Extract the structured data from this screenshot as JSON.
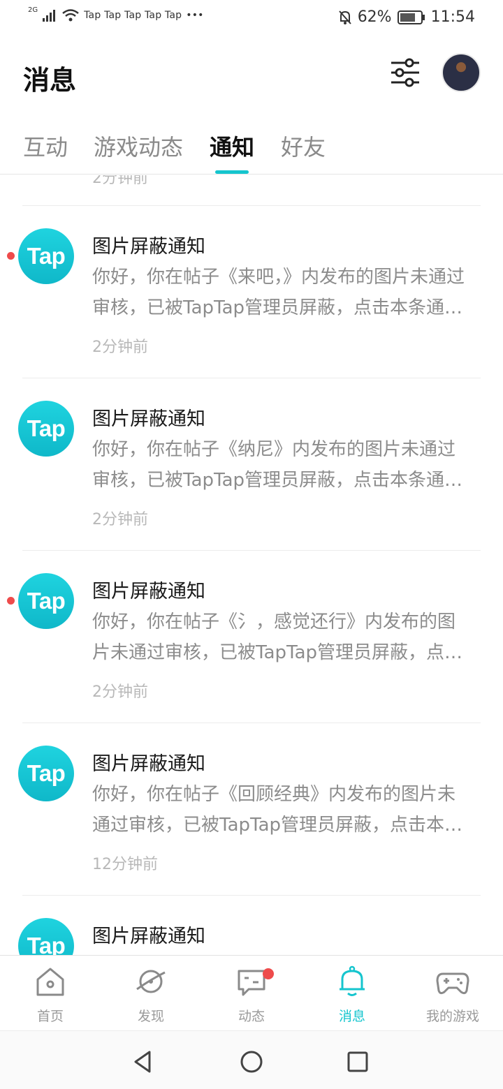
{
  "status_bar": {
    "network": "2G",
    "apps": "Tap Tap Tap Tap Tap",
    "more": "•••",
    "battery": "62%",
    "time": "11:54"
  },
  "header": {
    "title": "消息"
  },
  "tabs": [
    {
      "label": "互动",
      "active": false
    },
    {
      "label": "游戏动态",
      "active": false
    },
    {
      "label": "通知",
      "active": true
    },
    {
      "label": "好友",
      "active": false
    }
  ],
  "partial_prev_time": "2分钟前",
  "notifications": [
    {
      "logo": "Tap",
      "title": "图片屏蔽通知",
      "body": "你好，你在帖子《来吧，》内发布的图片未通过审核，已被TapTap管理员屏蔽，点击本条通知查看详情",
      "time": "2分钟前",
      "unread": true
    },
    {
      "logo": "Tap",
      "title": "图片屏蔽通知",
      "body": "你好，你在帖子《纳尼》内发布的图片未通过审核，已被TapTap管理员屏蔽，点击本条通知查看详情",
      "time": "2分钟前",
      "unread": false
    },
    {
      "logo": "Tap",
      "title": "图片屏蔽通知",
      "body": "你好，你在帖子《氵，感觉还行》内发布的图片未通过审核，已被TapTap管理员屏蔽，点击本条通知查看详情",
      "time": "2分钟前",
      "unread": true
    },
    {
      "logo": "Tap",
      "title": "图片屏蔽通知",
      "body": "你好，你在帖子《回顾经典》内发布的图片未通过审核，已被TapTap管理员屏蔽，点击本条通知查看详情",
      "time": "12分钟前",
      "unread": false
    },
    {
      "logo": "Tap",
      "title": "图片屏蔽通知",
      "body": "",
      "time": "",
      "unread": false
    }
  ],
  "bottom_nav": [
    {
      "label": "首页",
      "icon": "home-icon",
      "active": false,
      "badge": false
    },
    {
      "label": "发现",
      "icon": "planet-icon",
      "active": false,
      "badge": false
    },
    {
      "label": "动态",
      "icon": "chat-icon",
      "active": false,
      "badge": true
    },
    {
      "label": "消息",
      "icon": "bell-icon",
      "active": true,
      "badge": false
    },
    {
      "label": "我的游戏",
      "icon": "gamepad-icon",
      "active": false,
      "badge": false
    }
  ],
  "colors": {
    "accent": "#15c5ce",
    "badge": "#ee4b4b",
    "muted_text": "#8c8c8c"
  }
}
